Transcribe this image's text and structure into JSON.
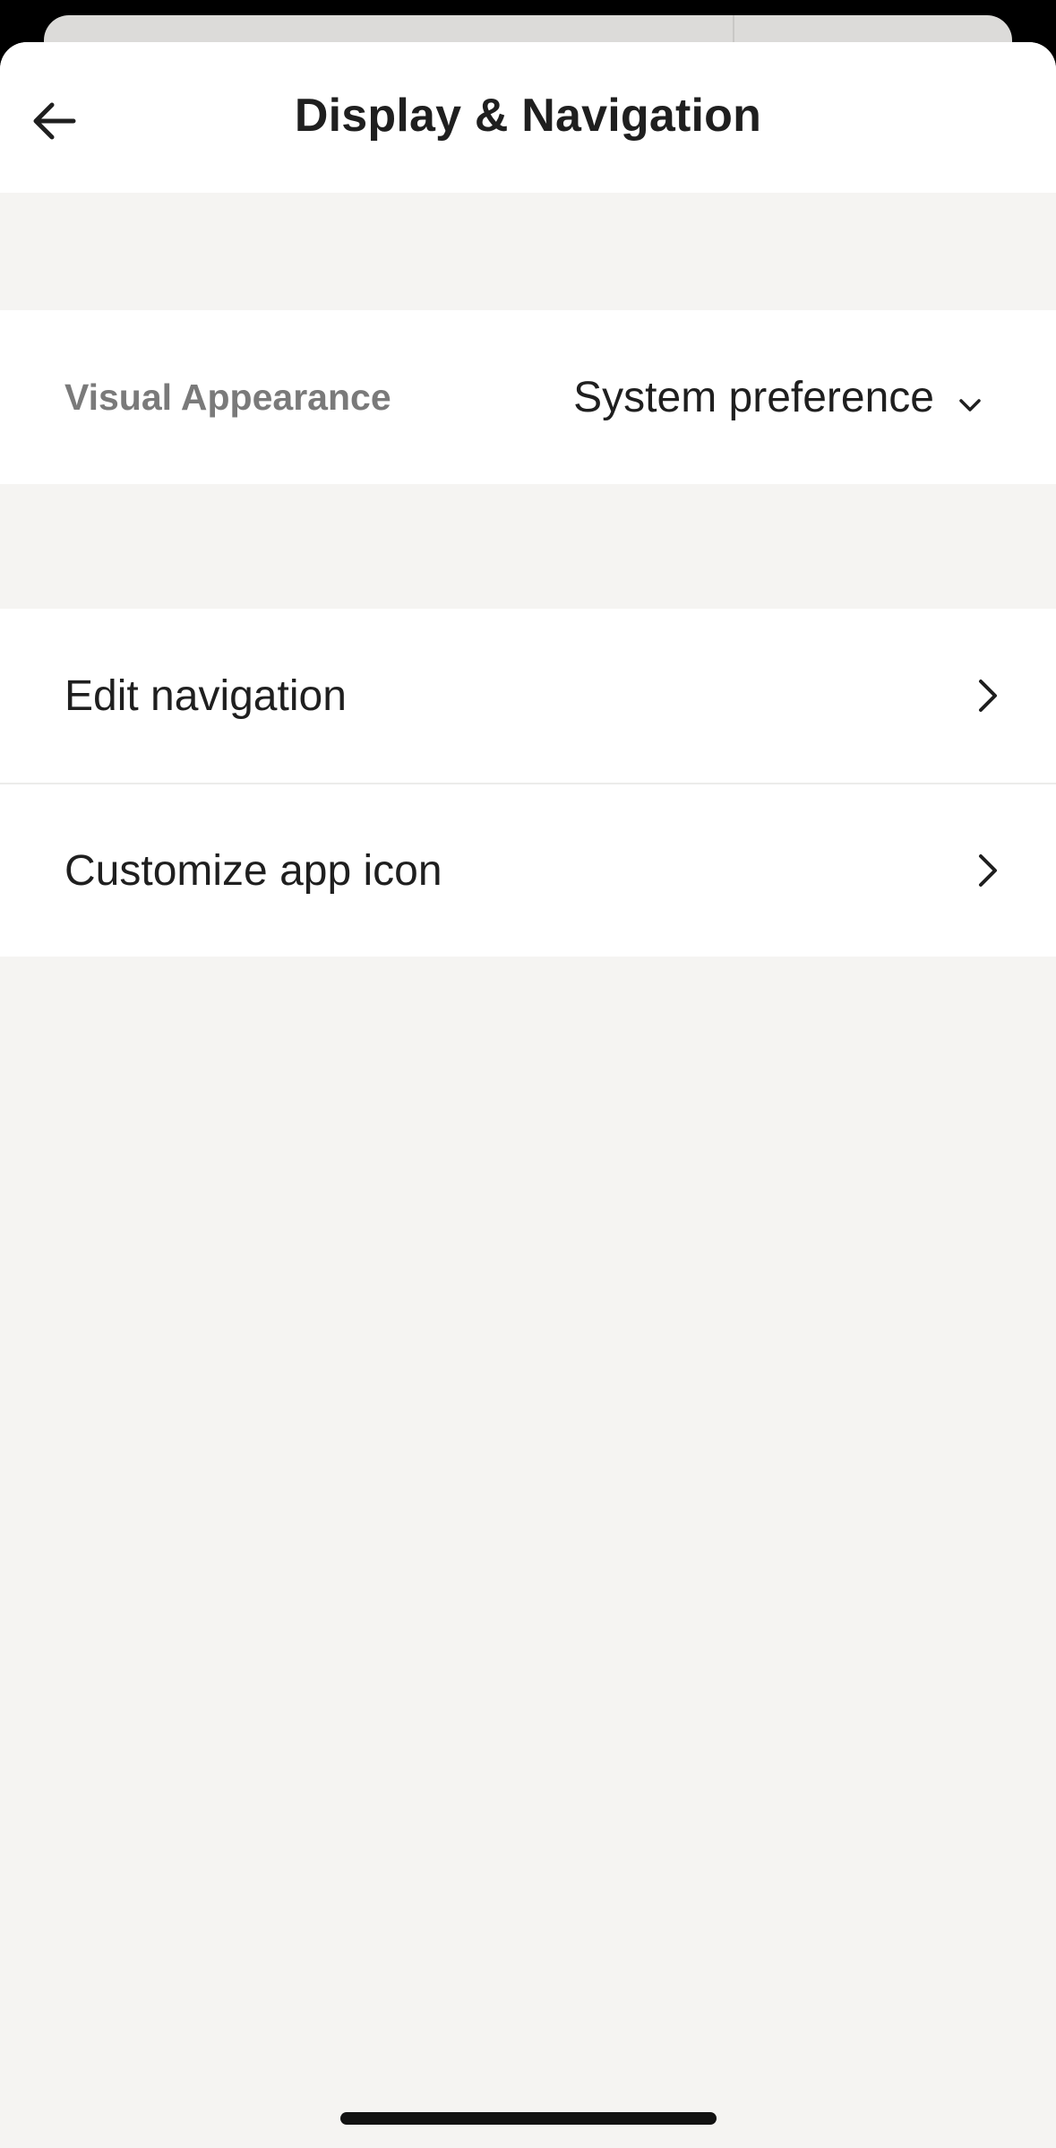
{
  "header": {
    "title": "Display & Navigation",
    "back_icon": "arrow-left-icon"
  },
  "appearance": {
    "label": "Visual Appearance",
    "value": "System preference",
    "icon": "chevron-down-icon"
  },
  "menu": {
    "items": [
      {
        "label": "Edit navigation",
        "icon": "chevron-right-icon"
      },
      {
        "label": "Customize app icon",
        "icon": "chevron-right-icon"
      }
    ]
  },
  "colors": {
    "background": "#f5f4f2",
    "surface": "#ffffff",
    "text": "#1f1f1f",
    "muted_text": "#7a7a7a"
  }
}
